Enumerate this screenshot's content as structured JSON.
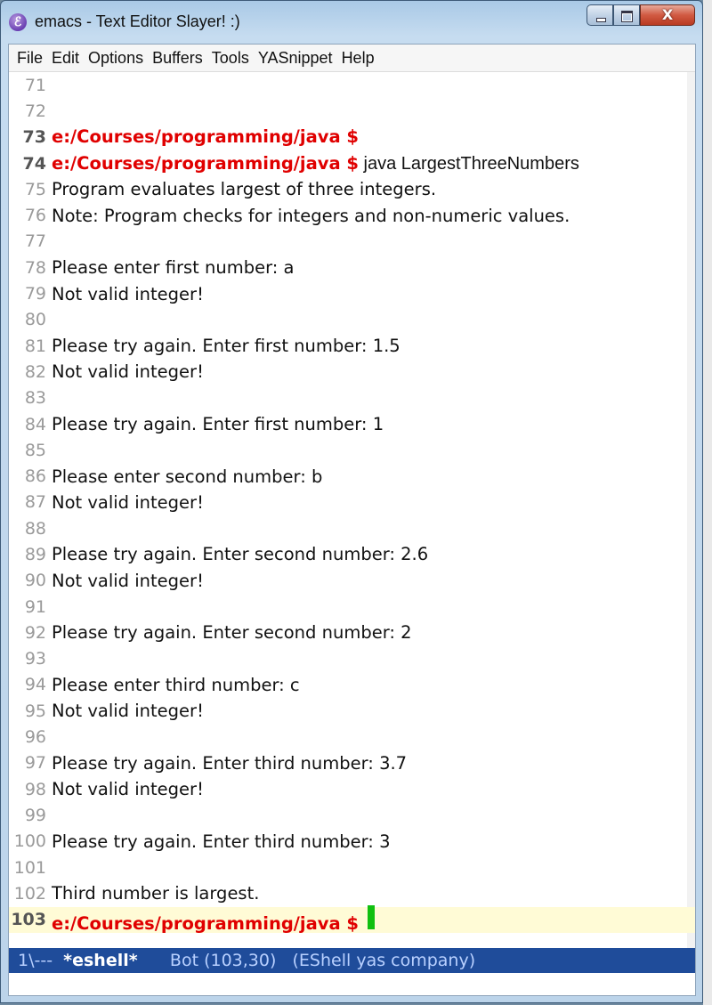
{
  "window": {
    "title": "emacs - Text Editor Slayer! :)",
    "app_icon": "emacs-icon",
    "controls": {
      "minimize": "minimize-icon",
      "maximize": "maximize-icon",
      "close": "X"
    }
  },
  "menubar": {
    "items": [
      "File",
      "Edit",
      "Options",
      "Buffers",
      "Tools",
      "YASnippet",
      "Help"
    ]
  },
  "colors": {
    "prompt": "#e00000",
    "cursor": "#10c010",
    "modeline_bg": "#1f4c9a",
    "current_line": "#fffbd6"
  },
  "editor": {
    "lines": [
      {
        "num": "71",
        "prompt": "",
        "text": "",
        "bold": false
      },
      {
        "num": "72",
        "prompt": "",
        "text": "",
        "bold": false
      },
      {
        "num": "73",
        "prompt": "e:/Courses/programming/java $",
        "text": "",
        "bold": true
      },
      {
        "num": "74",
        "prompt": "e:/Courses/programming/java $",
        "text": " java LargestThreeNumbers",
        "bold": true
      },
      {
        "num": "75",
        "prompt": "",
        "text": "Program evaluates largest of three integers.",
        "bold": false
      },
      {
        "num": "76",
        "prompt": "",
        "text": "Note: Program checks for integers and non-numeric values.",
        "bold": false
      },
      {
        "num": "77",
        "prompt": "",
        "text": "",
        "bold": false
      },
      {
        "num": "78",
        "prompt": "",
        "text": "Please enter first number: a",
        "bold": false
      },
      {
        "num": "79",
        "prompt": "",
        "text": "Not valid integer!",
        "bold": false
      },
      {
        "num": "80",
        "prompt": "",
        "text": "",
        "bold": false
      },
      {
        "num": "81",
        "prompt": "",
        "text": "Please try again. Enter first number: 1.5",
        "bold": false
      },
      {
        "num": "82",
        "prompt": "",
        "text": "Not valid integer!",
        "bold": false
      },
      {
        "num": "83",
        "prompt": "",
        "text": "",
        "bold": false
      },
      {
        "num": "84",
        "prompt": "",
        "text": "Please try again. Enter first number: 1",
        "bold": false
      },
      {
        "num": "85",
        "prompt": "",
        "text": "",
        "bold": false
      },
      {
        "num": "86",
        "prompt": "",
        "text": "Please enter second number: b",
        "bold": false
      },
      {
        "num": "87",
        "prompt": "",
        "text": "Not valid integer!",
        "bold": false
      },
      {
        "num": "88",
        "prompt": "",
        "text": "",
        "bold": false
      },
      {
        "num": "89",
        "prompt": "",
        "text": "Please try again. Enter second number: 2.6",
        "bold": false
      },
      {
        "num": "90",
        "prompt": "",
        "text": "Not valid integer!",
        "bold": false
      },
      {
        "num": "91",
        "prompt": "",
        "text": "",
        "bold": false
      },
      {
        "num": "92",
        "prompt": "",
        "text": "Please try again. Enter second number: 2",
        "bold": false
      },
      {
        "num": "93",
        "prompt": "",
        "text": "",
        "bold": false
      },
      {
        "num": "94",
        "prompt": "",
        "text": "Please enter third number: c",
        "bold": false
      },
      {
        "num": "95",
        "prompt": "",
        "text": "Not valid integer!",
        "bold": false
      },
      {
        "num": "96",
        "prompt": "",
        "text": "",
        "bold": false
      },
      {
        "num": "97",
        "prompt": "",
        "text": "Please try again. Enter third number: 3.7",
        "bold": false
      },
      {
        "num": "98",
        "prompt": "",
        "text": "Not valid integer!",
        "bold": false
      },
      {
        "num": "99",
        "prompt": "",
        "text": "",
        "bold": false
      },
      {
        "num": "100",
        "prompt": "",
        "text": "Please try again. Enter third number: 3",
        "bold": false
      },
      {
        "num": "101",
        "prompt": "",
        "text": "",
        "bold": false
      },
      {
        "num": "102",
        "prompt": "",
        "text": "Third number is largest.",
        "bold": false
      },
      {
        "num": "103",
        "prompt": "e:/Courses/programming/java $",
        "text": "",
        "bold": true,
        "current": true,
        "cursor": true
      }
    ]
  },
  "modeline": {
    "status": "1\\---",
    "buffer_name": "*eshell*",
    "position": "Bot (103,30)",
    "modes": "(EShell yas company)"
  },
  "minibuffer": {
    "text": ""
  }
}
